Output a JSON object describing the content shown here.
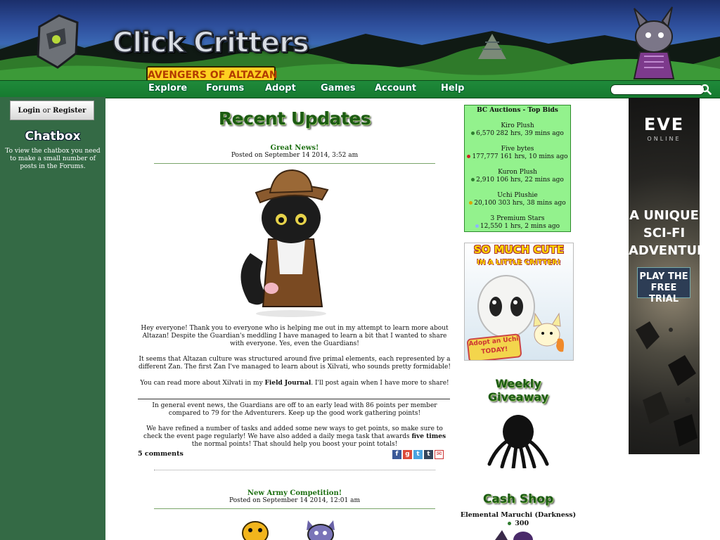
{
  "header": {
    "logo_title": "Click Critters",
    "logo_subtitle": "AVENGERS OF ALTAZAN"
  },
  "nav": {
    "items": [
      "Explore",
      "Forums",
      "Adopt",
      "Games",
      "Account",
      "Help"
    ],
    "search_placeholder": ""
  },
  "sidebar": {
    "login_label": "Login",
    "or_label": "or",
    "register_label": "Register",
    "chatbox_title": "Chatbox",
    "chatbox_text": "To view the chatbox you need to make a small number of posts in the Forums."
  },
  "main": {
    "title": "Recent Updates",
    "posts": [
      {
        "title": "Great News!",
        "date": "Posted on September 14 2014, 3:52 am",
        "p1": "Hey everyone! Thank you to everyone who is helping me out in my attempt to learn more about Altazan! Despite the Guardian's meddling I have managed to learn a bit that I wanted to share with everyone. Yes, even the Guardians!",
        "p2": "It seems that Altazan culture was structured around five primal elements, each represented by a different Zan. The first Zan I've managed to learn about is Xilvati, who sounds pretty formidable!",
        "p3_before": "You can read more about Xilvati in my ",
        "p3_link": "Field Journal",
        "p3_after": ". I'll post again when I have more to share!",
        "p4": "In general event news, the Guardians are off to an early lead with 86 points per member compared to 79 for the Adventurers. Keep up the good work gathering points!",
        "p5_before": "We have refined a number of tasks and added some new ways to get points, so make sure to check the event page regularly! We have also added a daily mega task that awards ",
        "p5_bold": "five times",
        "p5_after": " the normal points! That should help you boost your point totals!",
        "comments": "5 comments"
      },
      {
        "title": "New Army Competition!",
        "date": "Posted on September 14 2014, 12:01 am"
      }
    ],
    "share_icons": [
      "facebook-icon",
      "google-plus-icon",
      "twitter-icon",
      "tumblr-icon",
      "email-icon"
    ]
  },
  "auctions": {
    "title": "BC Auctions - Top Bids",
    "items": [
      {
        "name": "Kiro Plush",
        "bid": "6,570",
        "time": "282 hrs, 39 mins ago",
        "dot": "#2f7d2f"
      },
      {
        "name": "Five bytes",
        "bid": "177,777",
        "time": "161 hrs, 10 mins ago",
        "dot": "#cc2222"
      },
      {
        "name": "Kuron Plush",
        "bid": "2,910",
        "time": "106 hrs, 22 mins ago",
        "dot": "#2f7d2f"
      },
      {
        "name": "Uchi Plushie",
        "bid": "20,100",
        "time": "303 hrs, 38 mins ago",
        "dot": "#d9a400"
      },
      {
        "name": "3 Premium Stars",
        "bid": "12,550",
        "time": "1 hrs, 2 mins ago",
        "dot": "#8cb6ff"
      }
    ]
  },
  "cute_ad": {
    "title": "SO MUCH CUTE",
    "subtitle": "IN A LITTLE CRITTER!",
    "cta": "Adopt an Uchi TODAY!"
  },
  "weekly": {
    "title_line1": "Weekly",
    "title_line2": "Giveaway"
  },
  "cash_shop": {
    "title": "Cash Shop",
    "item": "Elemental Maruchi (Darkness)",
    "price": "300"
  },
  "eve_ad": {
    "logo": "EVE",
    "online": "ONLINE",
    "tag1": "A UNIQUE",
    "tag2": "SCI-FI",
    "tag3": "ADVENTURE",
    "cta1": "PLAY THE",
    "cta2": "FREE TRIAL"
  },
  "colors": {
    "nav_green": "#1f8a3a",
    "sidebar_green": "#346a45",
    "title_green": "#1c5b12",
    "auction_bg": "#93f28d"
  }
}
